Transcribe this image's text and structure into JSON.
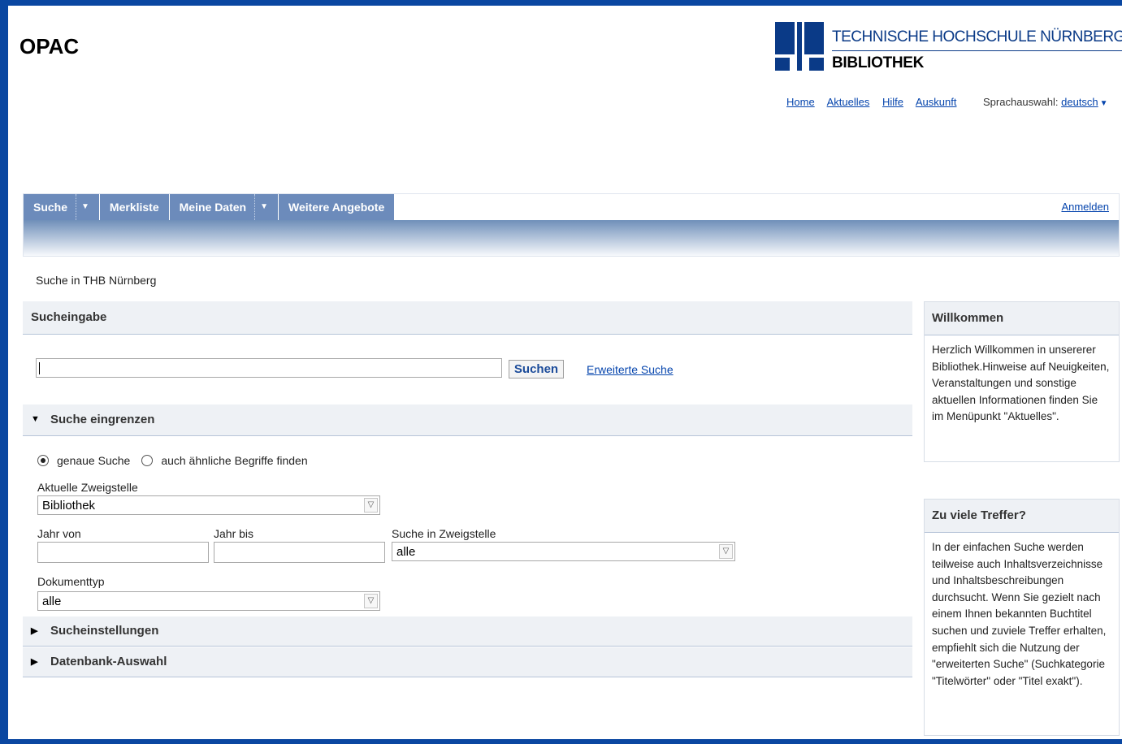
{
  "header": {
    "title": "OPAC",
    "logo_line1": "TECHNISCHE HOCHSCHULE NÜRNBERG",
    "logo_line2": "BIBLIOTHEK",
    "links": [
      {
        "label": "Home"
      },
      {
        "label": "Aktuelles"
      },
      {
        "label": "Hilfe"
      },
      {
        "label": "Auskunft"
      }
    ],
    "language_label": "Sprachauswahl:",
    "language_value": "deutsch"
  },
  "nav": {
    "tabs": [
      {
        "label": "Suche",
        "dropdown": true
      },
      {
        "label": "Merkliste",
        "dropdown": false
      },
      {
        "label": "Meine Daten",
        "dropdown": true
      },
      {
        "label": "Weitere Angebote",
        "dropdown": false
      }
    ],
    "login": "Anmelden"
  },
  "search_in": "Suche in THB Nürnberg",
  "search": {
    "section_title": "Sucheingabe",
    "input_value": "",
    "submit": "Suchen",
    "advanced": "Erweiterte Suche"
  },
  "refine": {
    "title": "Suche eingrenzen",
    "radio_exact": "genaue Suche",
    "radio_similar": "auch ähnliche Begriffe finden",
    "branch_label": "Aktuelle Zweigstelle",
    "branch_value": "Bibliothek",
    "year_from_label": "Jahr von",
    "year_to_label": "Jahr  bis",
    "search_branch_label": "Suche in Zweigstelle",
    "search_branch_value": "alle",
    "doctype_label": "Dokumenttyp",
    "doctype_value": "alle"
  },
  "sections": {
    "settings": "Sucheinstellungen",
    "database": "Datenbank-Auswahl"
  },
  "sidebar": {
    "welcome_title": "Willkommen",
    "welcome_text": "Herzlich Willkommen in unsererer Bibliothek.Hinweise auf Neuigkeiten, Veranstaltungen und sonstige aktuellen Informationen finden Sie im Menüpunkt \"Aktuelles\".",
    "hits_title": "Zu viele Treffer?",
    "hits_text": "In der einfachen Suche werden teilweise auch Inhaltsverzeichnisse und Inhaltsbeschreibungen durchsucht. Wenn Sie gezielt nach einem Ihnen bekannten Buchtitel suchen und zuviele Treffer erhalten, empfiehlt sich die Nutzung der \"erweiterten Suche\" (Suchkategorie \"Titelwörter\" oder \"Titel exakt\")."
  },
  "colors": {
    "frame": "#0a47a1",
    "nav_tab": "#6c8bbb",
    "link": "#0645ad"
  }
}
